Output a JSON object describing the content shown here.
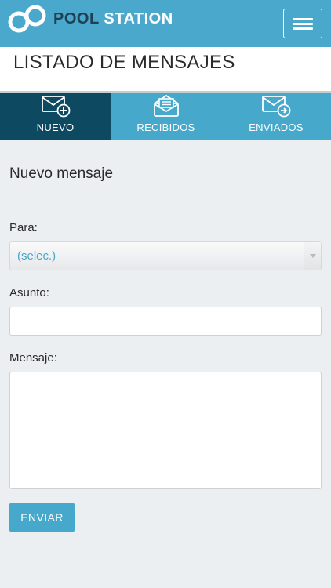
{
  "header": {
    "brand_pool": "POOL",
    "brand_station": "STATION",
    "logo_icon": "double-ring-logo",
    "menu_icon": "hamburger-icon"
  },
  "page": {
    "title": "LISTADO DE MENSAJES"
  },
  "tabs": [
    {
      "label": "NUEVO",
      "icon": "envelope-plus-icon",
      "active": true
    },
    {
      "label": "RECIBIDOS",
      "icon": "envelope-open-icon",
      "active": false
    },
    {
      "label": "ENVIADOS",
      "icon": "envelope-arrow-icon",
      "active": false
    }
  ],
  "form": {
    "section_title": "Nuevo mensaje",
    "to_label": "Para:",
    "to_value": "(selec.)",
    "subject_label": "Asunto:",
    "subject_value": "",
    "message_label": "Mensaje:",
    "message_value": "",
    "send_label": "ENVIAR"
  },
  "colors": {
    "header_bg": "#4aa8cc",
    "active_tab_bg": "#0d4a62",
    "accent": "#46a8cb",
    "page_bg": "#eceff1"
  }
}
